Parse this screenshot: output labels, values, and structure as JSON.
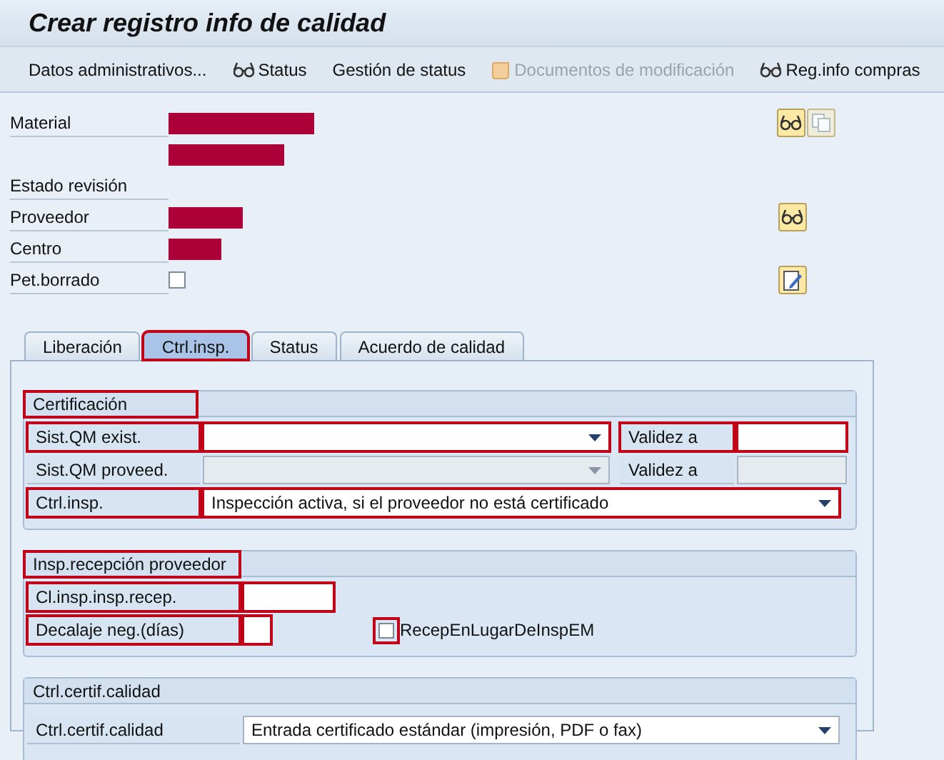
{
  "window": {
    "title": "Crear registro info de calidad"
  },
  "toolbar": [
    {
      "label": "Datos administrativos...",
      "disabled": false
    },
    {
      "label": "Status",
      "disabled": false
    },
    {
      "label": "Gestión de status",
      "disabled": false
    },
    {
      "label": "Documentos de modificación",
      "disabled": true
    },
    {
      "label": "Reg.info compras",
      "disabled": false
    }
  ],
  "header_fields": [
    {
      "label": "Material",
      "kind": "redacted"
    },
    {
      "kind": "redacted"
    },
    {
      "label": "Estado revisión",
      "kind": "empty"
    },
    {
      "label": "Proveedor",
      "kind": "redacted"
    },
    {
      "label": "Centro",
      "kind": "redacted"
    },
    {
      "label": "Pet.borrado",
      "kind": "checkbox",
      "checked": false
    }
  ],
  "tabs": [
    {
      "label": "Liberación",
      "selected": false,
      "highlighted": false
    },
    {
      "label": "Ctrl.insp.",
      "selected": true,
      "highlighted": true
    },
    {
      "label": "Status",
      "selected": false,
      "highlighted": false
    },
    {
      "label": "Acuerdo de calidad",
      "selected": false,
      "highlighted": false
    }
  ],
  "groups": [
    {
      "title": "Certificación",
      "highlighted": true,
      "rows": [
        {
          "label": "Sist.QM exist.",
          "label_highlighted": true,
          "kind": "select",
          "disabled": false,
          "field_highlighted": true,
          "extra": {
            "label": "Validez a",
            "label_highlighted": true,
            "disabled": false,
            "field_highlighted": true
          }
        },
        {
          "label": "Sist.QM proveed.",
          "label_highlighted": false,
          "kind": "select",
          "disabled": true,
          "field_highlighted": false,
          "extra": {
            "label": "Validez a",
            "label_highlighted": false,
            "disabled": true,
            "field_highlighted": false
          }
        },
        {
          "label": "Ctrl.insp.",
          "label_highlighted": true,
          "kind": "select",
          "disabled": false,
          "field_highlighted": true,
          "value": "Inspección activa, si el proveedor no está certificado"
        }
      ]
    },
    {
      "title": "Insp.recepción proveedor",
      "highlighted": true,
      "rows": [
        {
          "label": "Cl.insp.insp.recep.",
          "label_highlighted": true,
          "kind": "input",
          "disabled": false,
          "field_highlighted": true
        },
        {
          "label": "Decalaje neg.(días)",
          "label_highlighted": true,
          "kind": "input",
          "disabled": false,
          "field_highlighted": true,
          "checkbox": {
            "label": "RecepEnLugarDeInspEM",
            "checked": false,
            "highlighted": true
          }
        }
      ]
    },
    {
      "title": "Ctrl.certif.calidad",
      "highlighted": false,
      "rows": [
        {
          "label": "Ctrl.certif.calidad",
          "label_highlighted": false,
          "kind": "select",
          "disabled": false,
          "field_highlighted": false,
          "value": "Entrada certificado estándar (impresión, PDF o fax)"
        }
      ]
    }
  ]
}
